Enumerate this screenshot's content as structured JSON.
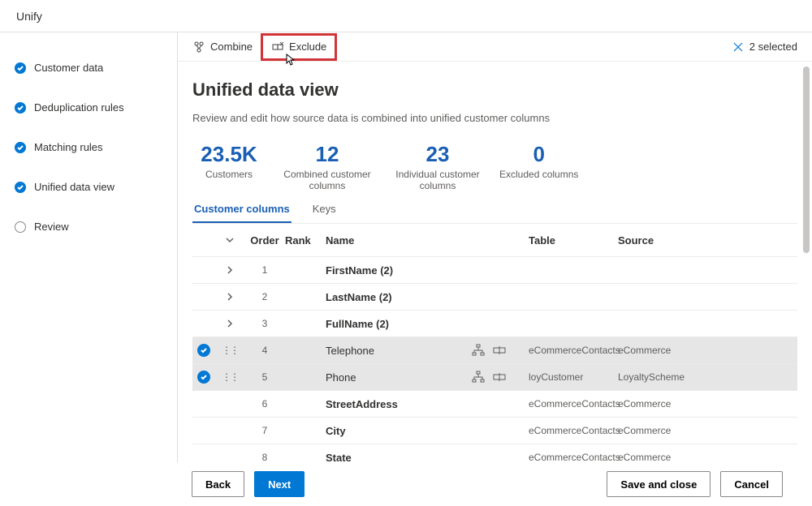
{
  "title": "Unify",
  "steps": [
    {
      "label": "Customer data",
      "done": true
    },
    {
      "label": "Deduplication rules",
      "done": true
    },
    {
      "label": "Matching rules",
      "done": true
    },
    {
      "label": "Unified data view",
      "done": true
    },
    {
      "label": "Review",
      "done": false
    }
  ],
  "toolbar": {
    "combine": "Combine",
    "exclude": "Exclude",
    "selected": "2 selected"
  },
  "header": "Unified data view",
  "desc": "Review and edit how source data is combined into unified customer columns",
  "stats": [
    {
      "num": "23.5K",
      "lbl": "Customers"
    },
    {
      "num": "12",
      "lbl": "Combined customer columns"
    },
    {
      "num": "23",
      "lbl": "Individual customer columns"
    },
    {
      "num": "0",
      "lbl": "Excluded columns"
    }
  ],
  "tabs": {
    "customer": "Customer columns",
    "keys": "Keys"
  },
  "cols": {
    "order": "Order",
    "rank": "Rank",
    "name": "Name",
    "table": "Table",
    "source": "Source"
  },
  "rows": [
    {
      "expand": true,
      "order": "1",
      "name": "FirstName (2)",
      "table": "",
      "source": "",
      "selected": false,
      "actions": false
    },
    {
      "expand": true,
      "order": "2",
      "name": "LastName (2)",
      "table": "",
      "source": "",
      "selected": false,
      "actions": false
    },
    {
      "expand": true,
      "order": "3",
      "name": "FullName (2)",
      "table": "",
      "source": "",
      "selected": false,
      "actions": false
    },
    {
      "expand": false,
      "order": "4",
      "name": "Telephone",
      "table": "eCommerceContacts",
      "source": "eCommerce",
      "selected": true,
      "actions": true,
      "grip": true
    },
    {
      "expand": false,
      "order": "5",
      "name": "Phone",
      "table": "loyCustomer",
      "source": "LoyaltyScheme",
      "selected": true,
      "actions": true,
      "grip": true
    },
    {
      "expand": false,
      "order": "6",
      "name": "StreetAddress",
      "table": "eCommerceContacts",
      "source": "eCommerce",
      "selected": false,
      "actions": false
    },
    {
      "expand": false,
      "order": "7",
      "name": "City",
      "table": "eCommerceContacts",
      "source": "eCommerce",
      "selected": false,
      "actions": false
    },
    {
      "expand": false,
      "order": "8",
      "name": "State",
      "table": "eCommerceContacts",
      "source": "eCommerce",
      "selected": false,
      "actions": false
    }
  ],
  "footer": {
    "back": "Back",
    "next": "Next",
    "save": "Save and close",
    "cancel": "Cancel"
  }
}
